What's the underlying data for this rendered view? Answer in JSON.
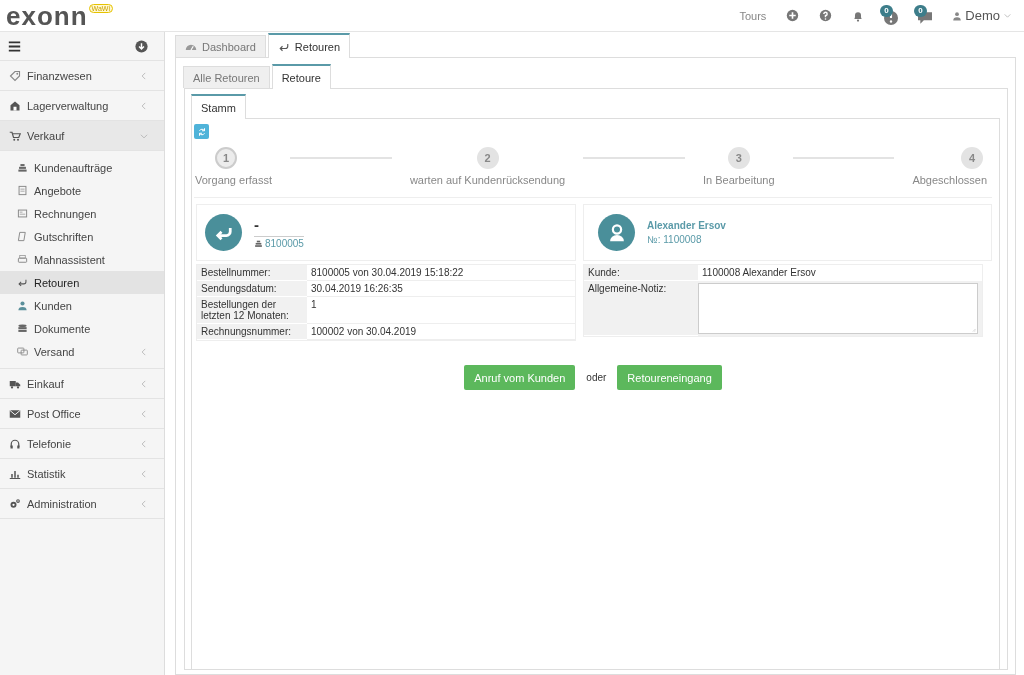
{
  "header": {
    "logo": "exonn",
    "logo_badge": "WaWi",
    "tours": "Tours",
    "notifications": [
      {
        "count": "0"
      },
      {
        "count": "0"
      }
    ],
    "user": "Demo"
  },
  "sidebar": {
    "items": [
      {
        "label": "Finanzwesen",
        "expanded": false
      },
      {
        "label": "Lagerverwaltung",
        "expanded": false
      },
      {
        "label": "Verkauf",
        "expanded": true,
        "children": [
          {
            "label": "Kundenaufträge",
            "selected": false,
            "has_submenu": false
          },
          {
            "label": "Angebote",
            "selected": false,
            "has_submenu": false
          },
          {
            "label": "Rechnungen",
            "selected": false,
            "has_submenu": false
          },
          {
            "label": "Gutschriften",
            "selected": false,
            "has_submenu": false
          },
          {
            "label": "Mahnassistent",
            "selected": false,
            "has_submenu": false
          },
          {
            "label": "Retouren",
            "selected": true,
            "has_submenu": false
          },
          {
            "label": "Kunden",
            "selected": false,
            "has_submenu": false
          },
          {
            "label": "Dokumente",
            "selected": false,
            "has_submenu": false
          },
          {
            "label": "Versand",
            "selected": false,
            "has_submenu": true
          }
        ]
      },
      {
        "label": "Einkauf",
        "expanded": false
      },
      {
        "label": "Post Office",
        "expanded": false
      },
      {
        "label": "Telefonie",
        "expanded": false
      },
      {
        "label": "Statistik",
        "expanded": false
      },
      {
        "label": "Administration",
        "expanded": false
      }
    ]
  },
  "main_tabs": [
    {
      "label": "Dashboard",
      "selected": false
    },
    {
      "label": "Retouren",
      "selected": true
    }
  ],
  "sub_tabs": [
    {
      "label": "Alle Retouren",
      "selected": false
    },
    {
      "label": "Retoure",
      "selected": true
    }
  ],
  "inner_tabs": [
    {
      "label": "Stamm",
      "selected": true
    }
  ],
  "steps": [
    {
      "number": "1",
      "label": "Vorgang erfasst",
      "selected": true
    },
    {
      "number": "2",
      "label": "warten auf Kundenrücksendung",
      "selected": false
    },
    {
      "number": "3",
      "label": "In Bearbeitung",
      "selected": false
    },
    {
      "number": "4",
      "label": "Abgeschlossen",
      "selected": false
    }
  ],
  "return_card": {
    "title": "-",
    "order_number": "8100005"
  },
  "customer_card": {
    "name": "Alexander Ersov",
    "number": "№: 1100008"
  },
  "order_details": [
    {
      "label": "Bestellnummer:",
      "value": "8100005 von 30.04.2019 15:18:22"
    },
    {
      "label": "Sendungsdatum:",
      "value": "30.04.2019 16:26:35"
    },
    {
      "label": "Bestellungen der letzten 12 Monaten:",
      "value": "1"
    },
    {
      "label": "Rechnungsnummer:",
      "value": "100002 von 30.04.2019"
    }
  ],
  "customer_details": {
    "customer_label": "Kunde:",
    "customer_value": "1100008 Alexander Ersov",
    "note_label": "Allgemeine-Notiz:"
  },
  "actions": {
    "primary": "Anruf vom Kunden",
    "separator": "oder",
    "secondary": "Retoureneingang"
  }
}
